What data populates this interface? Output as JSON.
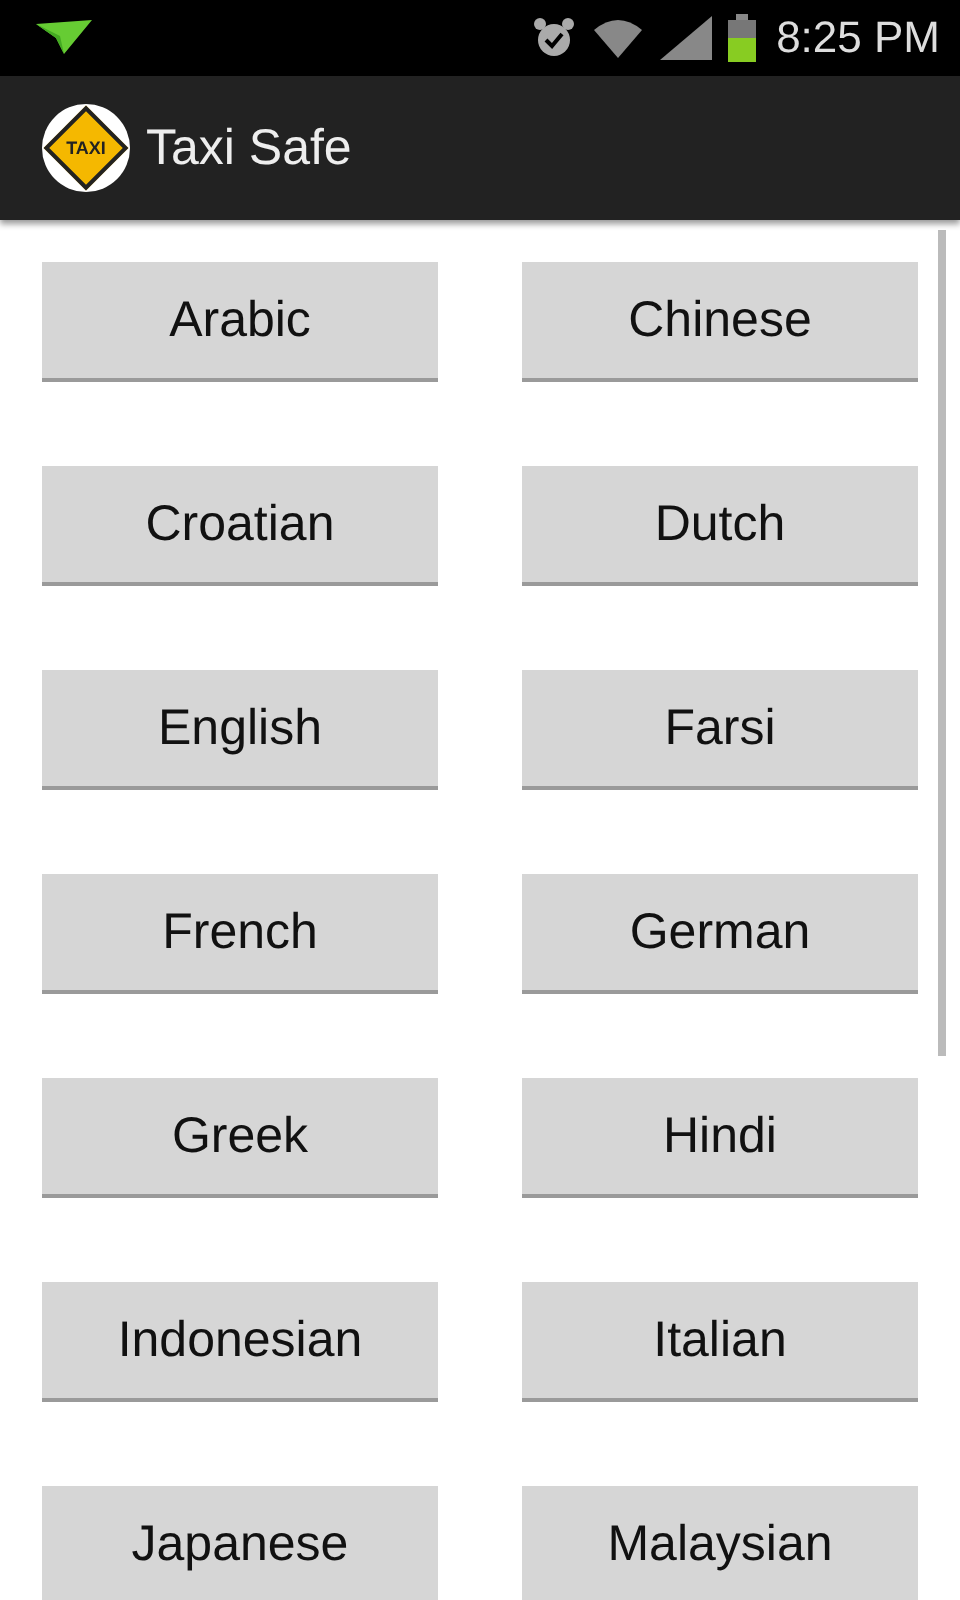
{
  "status_bar": {
    "time": "8:25 PM"
  },
  "app_bar": {
    "title": "Taxi Safe",
    "logo_text": "TAXI"
  },
  "languages": [
    {
      "label": "Arabic"
    },
    {
      "label": "Chinese"
    },
    {
      "label": "Croatian"
    },
    {
      "label": "Dutch"
    },
    {
      "label": "English"
    },
    {
      "label": "Farsi"
    },
    {
      "label": "French"
    },
    {
      "label": "German"
    },
    {
      "label": "Greek"
    },
    {
      "label": "Hindi"
    },
    {
      "label": "Indonesian"
    },
    {
      "label": "Italian"
    },
    {
      "label": "Japanese"
    },
    {
      "label": "Malaysian"
    }
  ]
}
